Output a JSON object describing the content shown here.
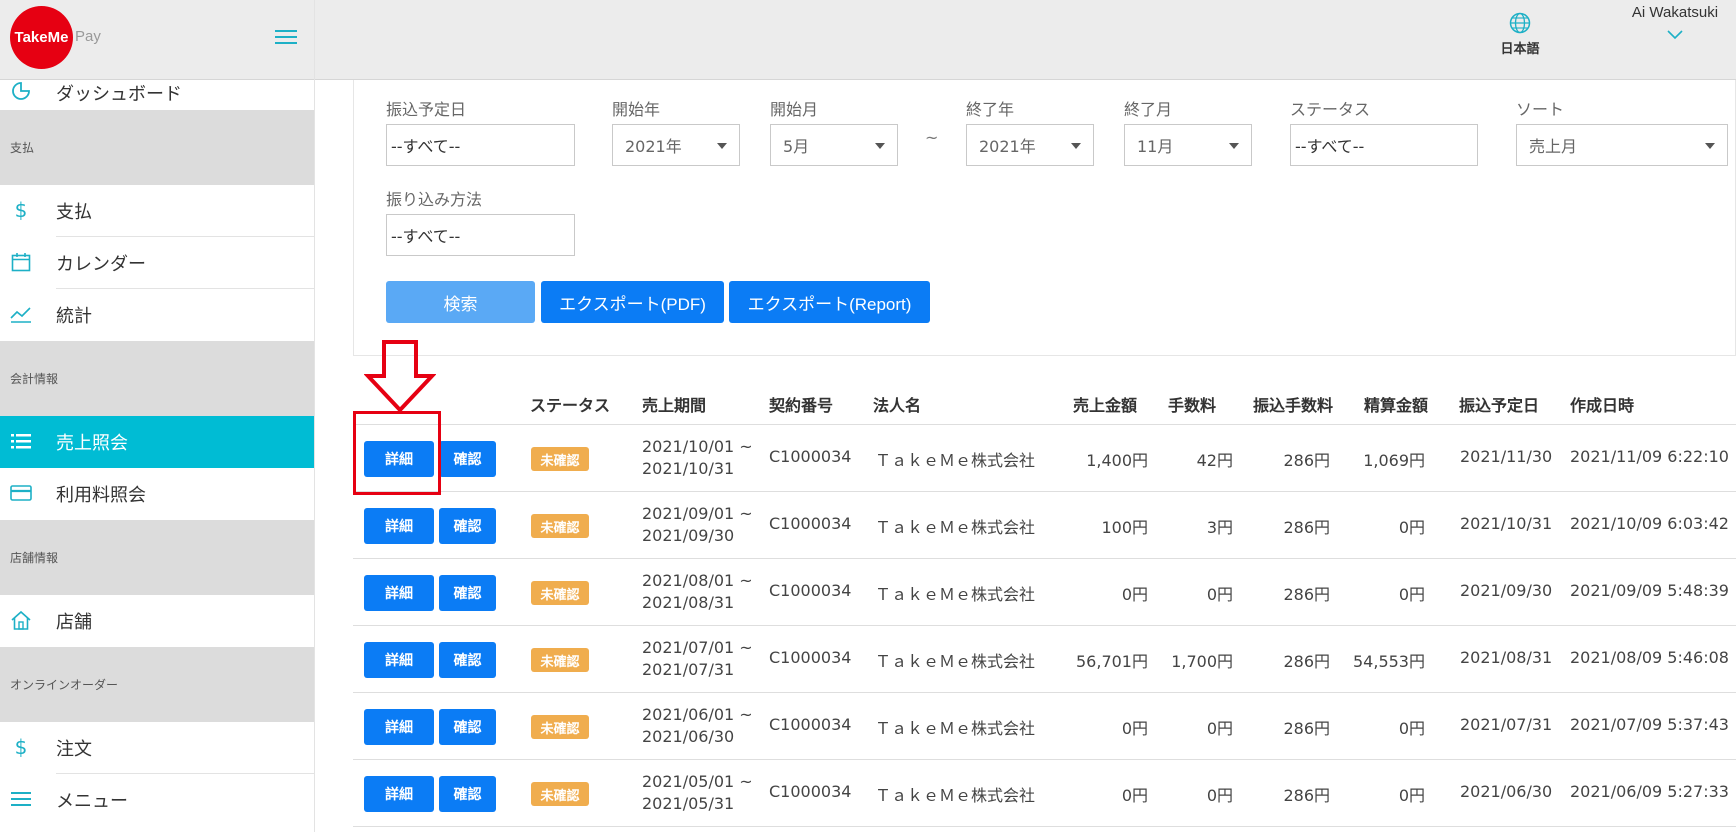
{
  "logo": {
    "name": "TakeMe",
    "suffix": "Pay"
  },
  "header": {
    "language": "日本語",
    "user_name": "Ai Wakatsuki"
  },
  "sidebar": {
    "top_item": "ダッシュボード",
    "sections": [
      {
        "title": "支払",
        "items": [
          {
            "label": "支払",
            "icon": "dollar-icon"
          },
          {
            "label": "カレンダー",
            "icon": "calendar-icon"
          },
          {
            "label": "統計",
            "icon": "chart-line-icon"
          }
        ]
      },
      {
        "title": "会計情報",
        "items": [
          {
            "label": "売上照会",
            "icon": "list-icon",
            "active": true
          },
          {
            "label": "利用料照会",
            "icon": "credit-card-icon"
          }
        ]
      },
      {
        "title": "店舗情報",
        "items": [
          {
            "label": "店舗",
            "icon": "home-icon"
          }
        ]
      },
      {
        "title": "オンラインオーダー",
        "items": [
          {
            "label": "注文",
            "icon": "dollar-icon"
          },
          {
            "label": "メニュー",
            "icon": "menu-icon"
          }
        ]
      }
    ]
  },
  "filters": {
    "transfer_date": {
      "label": "振込予定日",
      "value": "--すべて--"
    },
    "start_year": {
      "label": "開始年",
      "value": "2021年"
    },
    "start_month": {
      "label": "開始月",
      "value": "5月"
    },
    "range_sep": "~",
    "end_year": {
      "label": "終了年",
      "value": "2021年"
    },
    "end_month": {
      "label": "終了月",
      "value": "11月"
    },
    "status": {
      "label": "ステータス",
      "value": "--すべて--"
    },
    "sort": {
      "label": "ソート",
      "value": "売上月"
    },
    "transfer_method": {
      "label": "振り込み方法",
      "value": "--すべて--"
    }
  },
  "buttons": {
    "search": "検索",
    "export_pdf": "エクスポート(PDF)",
    "export_report": "エクスポート(Report)"
  },
  "table": {
    "headers": [
      "ステータス",
      "売上期間",
      "契約番号",
      "法人名",
      "売上金額",
      "手数料",
      "振込手数料",
      "精算金額",
      "振込予定日",
      "作成日時"
    ],
    "detail_label": "詳細",
    "confirm_label": "確認",
    "rows": [
      {
        "status": "未確認",
        "period_start": "2021/10/01 ~",
        "period_end": "2021/10/31",
        "contract": "C1000034",
        "company": "ＴａｋｅＭｅ株式会社",
        "sales": "1,400円",
        "fee": "42円",
        "transfer_fee": "286円",
        "settlement": "1,069円",
        "transfer_date": "2021/11/30",
        "created": "2021/11/09 6:22:10"
      },
      {
        "status": "未確認",
        "period_start": "2021/09/01 ~",
        "period_end": "2021/09/30",
        "contract": "C1000034",
        "company": "ＴａｋｅＭｅ株式会社",
        "sales": "100円",
        "fee": "3円",
        "transfer_fee": "286円",
        "settlement": "0円",
        "transfer_date": "2021/10/31",
        "created": "2021/10/09 6:03:42"
      },
      {
        "status": "未確認",
        "period_start": "2021/08/01 ~",
        "period_end": "2021/08/31",
        "contract": "C1000034",
        "company": "ＴａｋｅＭｅ株式会社",
        "sales": "0円",
        "fee": "0円",
        "transfer_fee": "286円",
        "settlement": "0円",
        "transfer_date": "2021/09/30",
        "created": "2021/09/09 5:48:39"
      },
      {
        "status": "未確認",
        "period_start": "2021/07/01 ~",
        "period_end": "2021/07/31",
        "contract": "C1000034",
        "company": "ＴａｋｅＭｅ株式会社",
        "sales": "56,701円",
        "fee": "1,700円",
        "transfer_fee": "286円",
        "settlement": "54,553円",
        "transfer_date": "2021/08/31",
        "created": "2021/08/09 5:46:08"
      },
      {
        "status": "未確認",
        "period_start": "2021/06/01 ~",
        "period_end": "2021/06/30",
        "contract": "C1000034",
        "company": "ＴａｋｅＭｅ株式会社",
        "sales": "0円",
        "fee": "0円",
        "transfer_fee": "286円",
        "settlement": "0円",
        "transfer_date": "2021/07/31",
        "created": "2021/07/09 5:37:43"
      },
      {
        "status": "未確認",
        "period_start": "2021/05/01 ~",
        "period_end": "2021/05/31",
        "contract": "C1000034",
        "company": "ＴａｋｅＭｅ株式会社",
        "sales": "0円",
        "fee": "0円",
        "transfer_fee": "286円",
        "settlement": "0円",
        "transfer_date": "2021/06/30",
        "created": "2021/06/09 5:27:33"
      }
    ]
  },
  "colors": {
    "accent": "#00bcd4",
    "button": "#0b7cf5",
    "badge": "#f0ad4e",
    "annotation": "#e60012"
  }
}
